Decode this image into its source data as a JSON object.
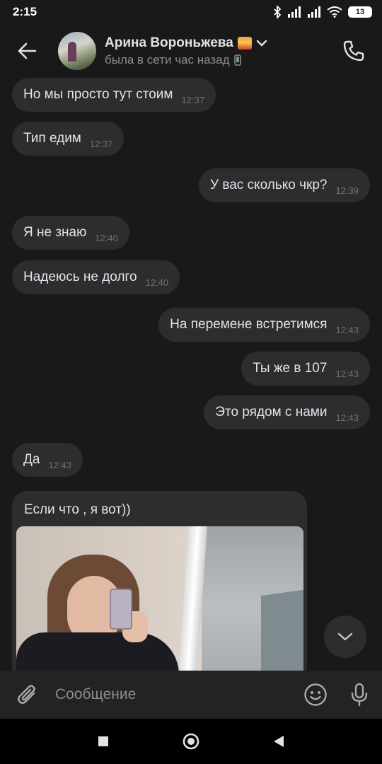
{
  "status_bar": {
    "time": "2:15",
    "battery": "13",
    "icons": [
      "bluetooth-icon",
      "signal-icon",
      "signal-icon",
      "wifi-icon",
      "battery-icon"
    ]
  },
  "header": {
    "name": "Арина Вороньжева",
    "name_emoji": "sunset-emoji",
    "status": "была в сети час назад",
    "status_device": "phone-icon",
    "back_icon": "arrow-left-icon",
    "call_icon": "phone-call-icon",
    "expand_icon": "chevron-down-icon"
  },
  "messages": [
    {
      "direction": "in",
      "text": "Но мы просто тут стоим",
      "time": "12:37"
    },
    {
      "direction": "in",
      "text": "Тип едим",
      "time": "12:37"
    },
    {
      "direction": "out",
      "text": "У вас сколько чкр?",
      "time": "12:39"
    },
    {
      "direction": "in",
      "text": "Я не знаю",
      "time": "12:40"
    },
    {
      "direction": "in",
      "text": "Надеюсь не долго",
      "time": "12:40"
    },
    {
      "direction": "out",
      "text": "На перемене встретимся",
      "time": "12:43"
    },
    {
      "direction": "out",
      "text": "Ты же в 107",
      "time": "12:43"
    },
    {
      "direction": "out",
      "text": "Это рядом с нами",
      "time": "12:43"
    },
    {
      "direction": "in",
      "text": "Да",
      "time": "12:43"
    }
  ],
  "photo_message": {
    "direction": "in",
    "caption": "Если что , я вот))"
  },
  "composer": {
    "placeholder": "Сообщение",
    "attach_icon": "paperclip-icon",
    "emoji_icon": "smile-icon",
    "mic_icon": "microphone-icon"
  },
  "scroll_button_icon": "chevron-down-icon",
  "nav": {
    "icons": [
      "recents-square-icon",
      "home-circle-icon",
      "back-triangle-icon"
    ]
  },
  "colors": {
    "background": "#19191a",
    "bubble": "#2d2d2f",
    "text": "#e1e3e6",
    "muted": "#8a8c90"
  }
}
